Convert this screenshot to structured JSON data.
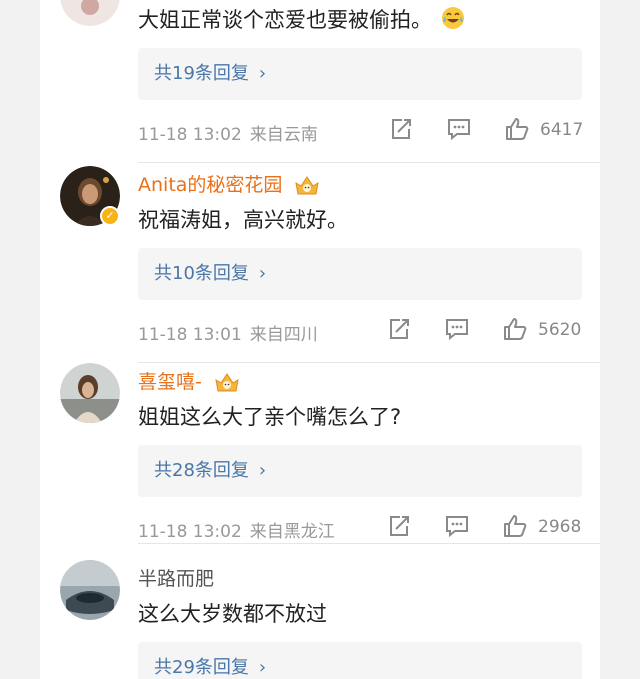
{
  "comments": [
    {
      "id": "c1",
      "username": "",
      "text": "大姐正常谈个恋爱也要被偷拍。",
      "emoji": "laugh-cry",
      "replies_label": "共19条回复",
      "time": "11-18 13:02",
      "location": "来自云南",
      "likes": "6417"
    },
    {
      "id": "c2",
      "username": "Anita的秘密花园",
      "verified": true,
      "text": "祝福涛姐，高兴就好。",
      "replies_label": "共10条回复",
      "time": "11-18 13:01",
      "location": "来自四川",
      "likes": "5620"
    },
    {
      "id": "c3",
      "username": "喜玺嘻-",
      "text": "姐姐这么大了亲个嘴怎么了?",
      "replies_label": "共28条回复",
      "time": "11-18 13:02",
      "location": "来自黑龙江",
      "likes": "2968"
    },
    {
      "id": "c4",
      "username": "半路而肥",
      "text": "这么大岁数都不放过",
      "replies_label": "共29条回复",
      "time": "",
      "location": "",
      "likes": ""
    }
  ],
  "icons": {
    "share": "share-icon",
    "comment": "comment-icon",
    "like": "thumbs-up-icon",
    "verified": "verified-icon",
    "chevron": "chevron-right-icon"
  },
  "colors": {
    "username": "#e8711a",
    "link": "#4a76a8",
    "meta": "#999999",
    "verified": "#f8b416"
  }
}
